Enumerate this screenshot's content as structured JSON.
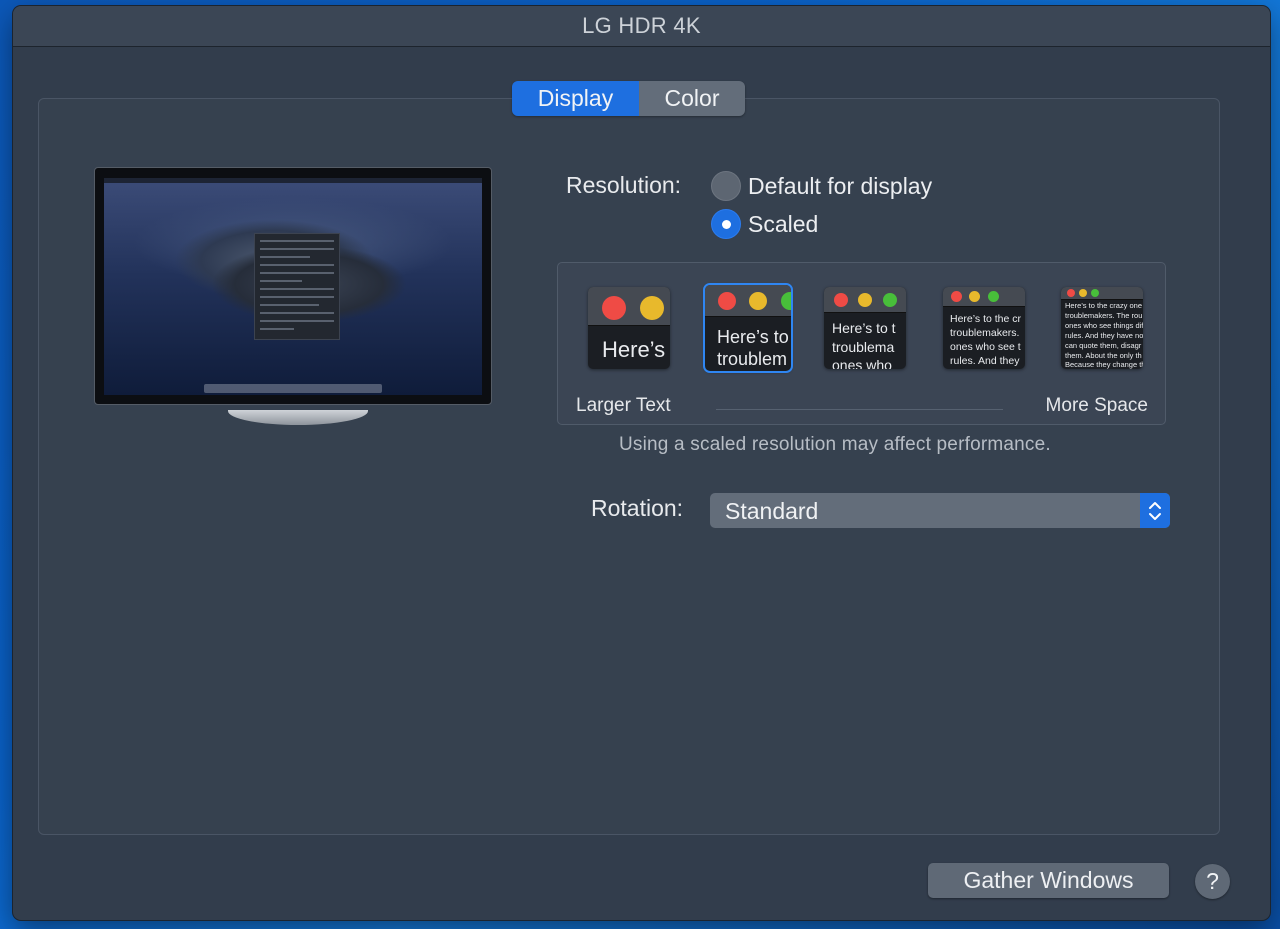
{
  "window": {
    "title": "LG HDR 4K"
  },
  "tabs": [
    {
      "label": "Display",
      "selected": true
    },
    {
      "label": "Color",
      "selected": false
    }
  ],
  "resolution": {
    "label": "Resolution:",
    "options": [
      {
        "label": "Default for display",
        "selected": false
      },
      {
        "label": "Scaled",
        "selected": true
      }
    ],
    "scale": {
      "left_label": "Larger Text",
      "right_label": "More Space",
      "selected_index": 1,
      "thumbnails": [
        {
          "lines": [
            "Here’s"
          ]
        },
        {
          "lines": [
            "Here’s to",
            "troublem"
          ]
        },
        {
          "lines": [
            "Here’s to t",
            "troublema",
            "ones who"
          ]
        },
        {
          "lines": [
            "Here’s to the cr",
            "troublemakers.",
            "ones who see t",
            "rules. And they"
          ]
        },
        {
          "lines": [
            "Here’s to the crazy one",
            "troublemakers. The rou",
            "ones who see things dif",
            "rules. And they have no",
            "can quote them, disagr",
            "them. About the only th",
            "Because they change th"
          ]
        }
      ]
    },
    "note": "Using a scaled resolution may affect performance."
  },
  "rotation": {
    "label": "Rotation:",
    "value": "Standard"
  },
  "buttons": {
    "gather_windows": "Gather Windows",
    "help": "?"
  },
  "icons": {
    "select_arrows": "chevron-up-down-icon",
    "help": "question-mark-icon"
  },
  "colors": {
    "accent": "#1e6fe0",
    "window_bg": "#323d4c"
  }
}
